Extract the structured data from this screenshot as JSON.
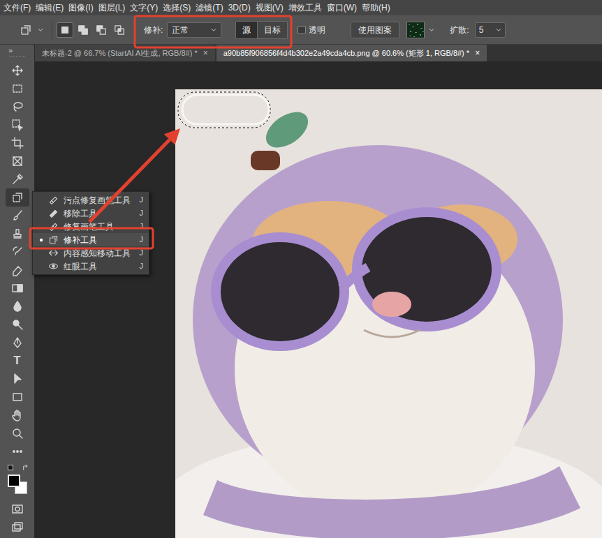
{
  "menu": [
    "文件(F)",
    "编辑(E)",
    "图像(I)",
    "图层(L)",
    "文字(Y)",
    "选择(S)",
    "滤镜(T)",
    "3D(D)",
    "视图(V)",
    "增效工具",
    "窗口(W)",
    "帮助(H)"
  ],
  "options": {
    "selection_modes": [
      {
        "selected": true
      },
      {
        "selected": false
      },
      {
        "selected": false
      },
      {
        "selected": false
      }
    ],
    "patch_label": "修补:",
    "patch_mode": "正常",
    "source_target": [
      {
        "label": "源",
        "selected": true
      },
      {
        "label": "目标",
        "selected": false
      }
    ],
    "transparent": {
      "label": "透明",
      "checked": false
    },
    "use_pattern": "使用图案",
    "diffusion_label": "扩散:",
    "diffusion_value": "5"
  },
  "tabs": [
    {
      "label": "未标题-2 @ 66.7% (StartAI AI生成, RGB/8#) *",
      "close": "×",
      "selected": false
    },
    {
      "label": "a90b85f906856f4d4b302e2a49cda4cb.png @ 60.6% (矩形 1, RGB/8#) *",
      "close": "×",
      "selected": true
    }
  ],
  "toolbar": {
    "collapse": "»",
    "tools": [
      {
        "selected": false
      },
      {
        "selected": false
      },
      {
        "selected": false
      },
      {
        "selected": false
      },
      {
        "selected": false
      },
      {
        "selected": false
      },
      {
        "selected": false
      },
      {
        "selected": true
      },
      {
        "selected": false
      },
      {
        "selected": false
      },
      {
        "selected": false
      },
      {
        "selected": false
      },
      {
        "selected": false
      },
      {
        "selected": false
      },
      {
        "selected": false
      },
      {
        "selected": false
      },
      {
        "selected": false,
        "glyph": "T"
      },
      {
        "selected": false
      },
      {
        "selected": false
      },
      {
        "selected": false
      },
      {
        "selected": false
      },
      {
        "selected": false
      }
    ],
    "colors": {
      "foreground": "#000000",
      "background": "#ffffff"
    },
    "bottom_tools": [
      {
        "selected": false
      },
      {
        "selected": false
      }
    ]
  },
  "flyout": {
    "items": [
      {
        "label": "污点修复画笔工具",
        "shortcut": "J",
        "selected": false
      },
      {
        "label": "移除工具",
        "shortcut": "J",
        "selected": false
      },
      {
        "label": "修复画笔工具",
        "shortcut": "J",
        "selected": false
      },
      {
        "label": "修补工具",
        "shortcut": "J",
        "selected": true
      },
      {
        "label": "内容感知移动工具",
        "shortcut": "J",
        "selected": false
      },
      {
        "label": "红眼工具",
        "shortcut": "J",
        "selected": false
      }
    ]
  },
  "canvas": {
    "selection_active": true
  },
  "annotations": {
    "options_box": true,
    "flyout_box": true,
    "arrow": true
  }
}
